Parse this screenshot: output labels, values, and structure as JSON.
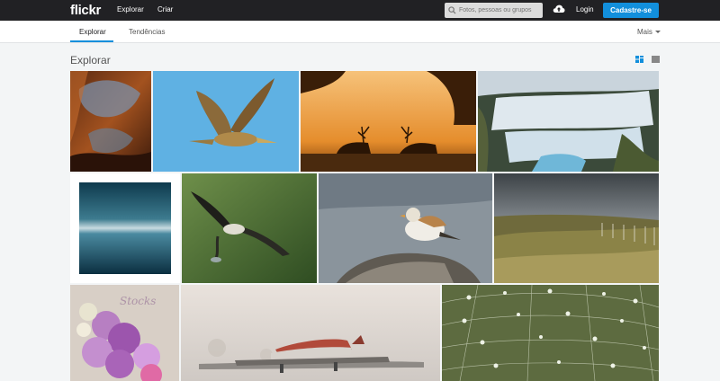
{
  "header": {
    "logo": "flickr",
    "nav": [
      "Explorar",
      "Criar"
    ],
    "search_placeholder": "Fotos, pessoas ou grupos",
    "login": "Login",
    "signup": "Cadastre-se",
    "icons": {
      "search": "search-icon",
      "upload": "cloud-upload-icon"
    }
  },
  "subnav": {
    "tabs": [
      {
        "label": "Explorar",
        "active": true
      },
      {
        "label": "Tendências",
        "active": false
      }
    ],
    "more": "Mais"
  },
  "page": {
    "title": "Explorar",
    "view_icons": [
      "justified-view-icon",
      "grid-view-icon"
    ]
  },
  "colors": {
    "topbar": "#212124",
    "accent": "#128fdc",
    "background": "#f3f5f6"
  },
  "photos": [
    {
      "id": "canyon-rock"
    },
    {
      "id": "bird-flight-blue-sky"
    },
    {
      "id": "deer-silhouette-sunset"
    },
    {
      "id": "waterfall-cascade"
    },
    {
      "id": "minimal-seascape"
    },
    {
      "id": "osprey-catching-fish"
    },
    {
      "id": "snow-bunting-on-rock"
    },
    {
      "id": "grassland-fence-stormy-sky"
    },
    {
      "id": "purple-flowers"
    },
    {
      "id": "airplane-in-fog"
    },
    {
      "id": "spiderweb-dew-drops"
    }
  ]
}
